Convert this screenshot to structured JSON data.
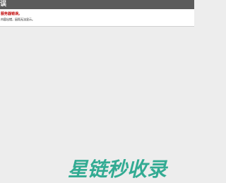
{
  "header": {
    "title": "误"
  },
  "error": {
    "heading": "服务器错误。",
    "detail": "内容出错，因而无法显示。"
  },
  "watermark": {
    "text": "星链秒收录",
    "color": "#2aa88f"
  },
  "colors": {
    "header_bg": "#5b5b5b",
    "page_bg": "#ededed",
    "error_text": "#c00000"
  }
}
